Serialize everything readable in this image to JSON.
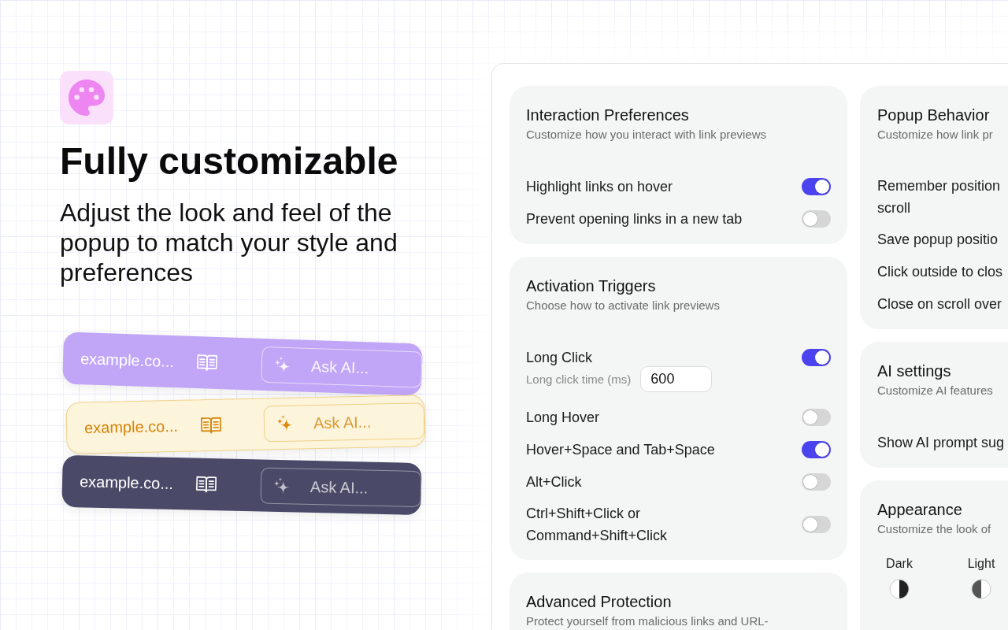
{
  "hero": {
    "title": "Fully customizable",
    "subtitle": "Adjust the look and feel of the popup to match your style and preferences"
  },
  "preview_cards": [
    {
      "kind": "vivid",
      "color": "#c1a5f7",
      "url": "example.co...",
      "placeholder": "Ask AI..."
    },
    {
      "kind": "warm",
      "color": "#fdf4dc",
      "url": "example.co...",
      "placeholder": "Ask AI..."
    },
    {
      "kind": "dark",
      "color": "#4a4a68",
      "url": "example.co...",
      "placeholder": "Ask AI..."
    }
  ],
  "settings": {
    "columns": [
      [
        {
          "title": "Interaction Preferences",
          "subtitle": "Customize how you interact with link previews",
          "rows": [
            {
              "label": "Highlight links on hover",
              "on": true
            },
            {
              "label": "Prevent opening links in a new tab",
              "on": false
            }
          ]
        },
        {
          "title": "Activation Triggers",
          "subtitle": "Choose how to activate link previews",
          "rows": [
            {
              "label": "Long Click",
              "on": true,
              "field": {
                "label": "Long click time (ms)",
                "value": "600"
              }
            },
            {
              "label": "Long Hover",
              "on": false
            },
            {
              "label": "Hover+Space and Tab+Space",
              "on": true
            },
            {
              "label": "Alt+Click",
              "on": false
            },
            {
              "label": "Ctrl+Shift+Click or\nCommand+Shift+Click",
              "on": false
            }
          ]
        },
        {
          "title": "Advanced Protection",
          "subtitle": "Protect yourself from malicious links and URL-"
        }
      ],
      [
        {
          "title": "Popup Behavior",
          "subtitle": "Customize how link pr",
          "rows": [
            {
              "label": "Remember position\nscroll"
            },
            {
              "label": "Save popup positio"
            },
            {
              "label": "Click outside to clos"
            },
            {
              "label": "Close on scroll over"
            }
          ]
        },
        {
          "title": "AI settings",
          "subtitle": "Customize AI features",
          "rows": [
            {
              "label": "Show AI prompt sug"
            }
          ]
        },
        {
          "title": "Appearance",
          "subtitle": "Customize the look of",
          "themes": [
            {
              "label": "Dark",
              "kind": "dark"
            },
            {
              "label": "Light",
              "kind": "light"
            }
          ]
        }
      ]
    ]
  }
}
